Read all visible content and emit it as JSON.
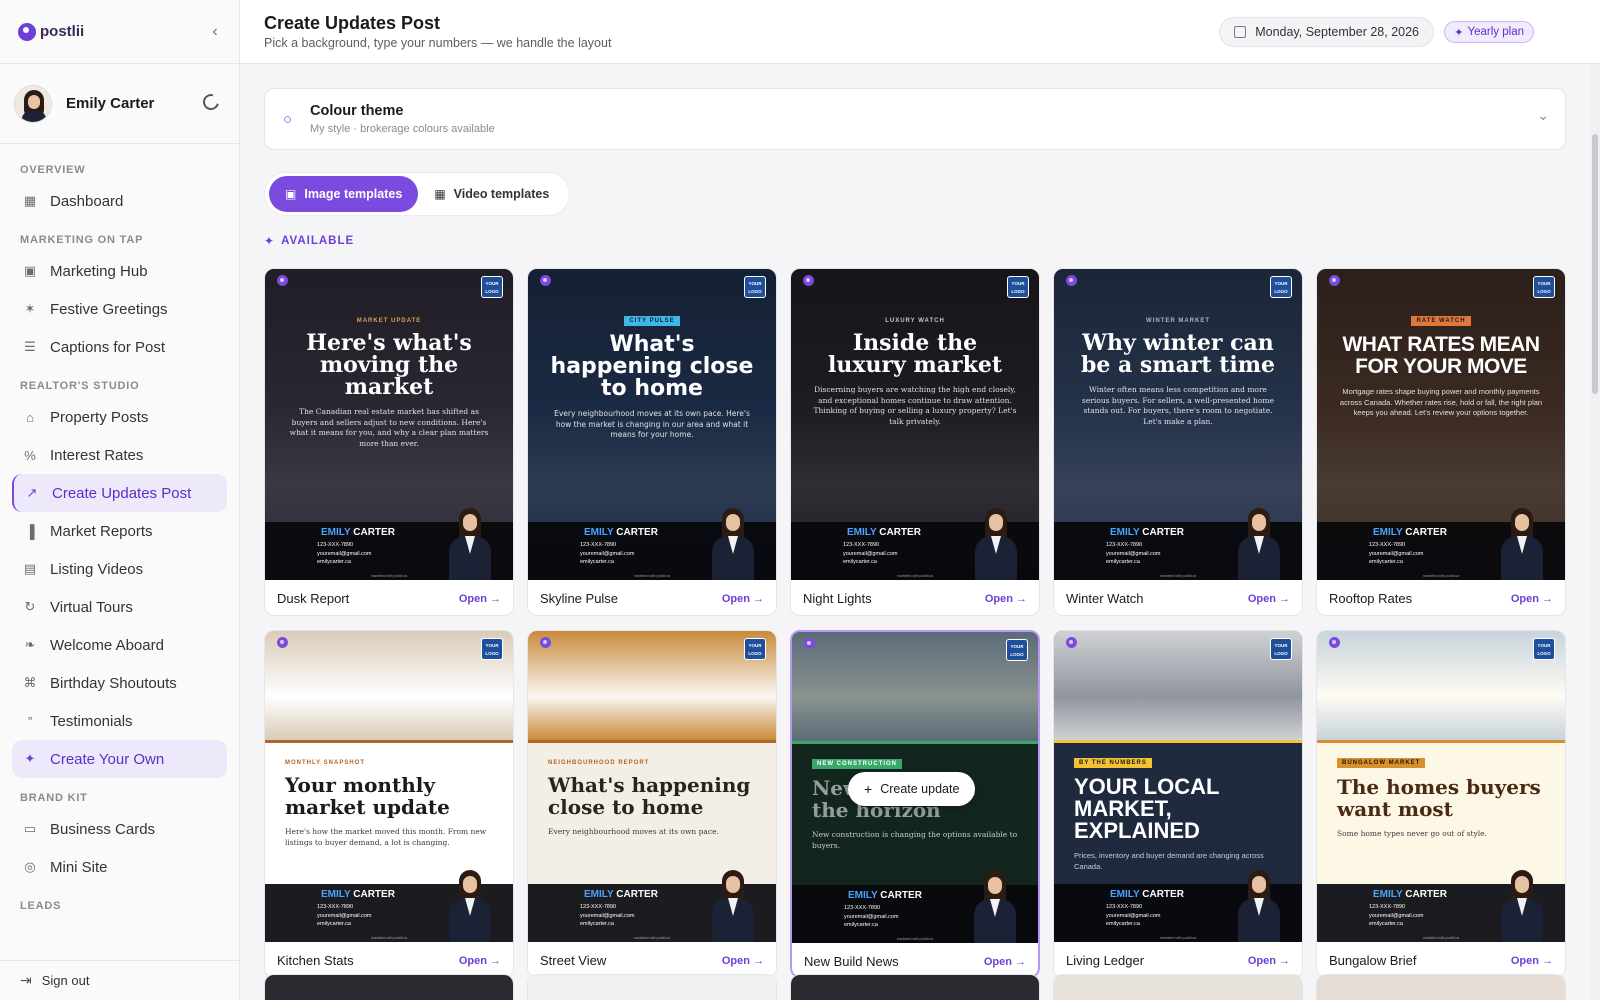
{
  "brand": {
    "name": "postlii"
  },
  "profile": {
    "name": "Emily Carter"
  },
  "nav": {
    "sections": [
      {
        "title": "OVERVIEW",
        "items": [
          {
            "label": "Dashboard",
            "icon": "grid-icon"
          }
        ]
      },
      {
        "title": "MARKETING ON TAP",
        "items": [
          {
            "label": "Marketing Hub",
            "icon": "image-icon"
          },
          {
            "label": "Festive Greetings",
            "icon": "party-icon"
          },
          {
            "label": "Captions for Post",
            "icon": "caption-icon"
          }
        ]
      },
      {
        "title": "REALTOR'S STUDIO",
        "items": [
          {
            "label": "Property Posts",
            "icon": "home-icon"
          },
          {
            "label": "Interest Rates",
            "icon": "percent-icon"
          },
          {
            "label": "Create Updates Post",
            "icon": "trend-icon",
            "active": true
          },
          {
            "label": "Market Reports",
            "icon": "bar-chart-icon"
          },
          {
            "label": "Listing Videos",
            "icon": "video-icon"
          },
          {
            "label": "Virtual Tours",
            "icon": "rotate-icon"
          },
          {
            "label": "Welcome Aboard",
            "icon": "handshake-icon"
          },
          {
            "label": "Birthday Shoutouts",
            "icon": "cake-icon"
          },
          {
            "label": "Testimonials",
            "icon": "quote-icon"
          },
          {
            "label": "Create Your Own",
            "icon": "sparkle-icon",
            "highlight": true
          }
        ]
      },
      {
        "title": "BRAND KIT",
        "items": [
          {
            "label": "Business Cards",
            "icon": "card-icon"
          },
          {
            "label": "Mini Site",
            "icon": "globe-icon"
          }
        ]
      },
      {
        "title": "LEADS",
        "items": []
      }
    ],
    "signout": "Sign out"
  },
  "header": {
    "title": "Create Updates Post",
    "subtitle": "Pick a background, type your numbers — we handle the layout",
    "date": "Monday, September 28, 2026",
    "plan": "Yearly plan"
  },
  "theme": {
    "title": "Colour theme",
    "subtitle": "My style · brokerage colours available"
  },
  "tabs": [
    {
      "label": "Image templates",
      "active": true
    },
    {
      "label": "Video templates",
      "active": false
    }
  ],
  "section_label": "AVAILABLE",
  "open_label": "Open →",
  "create_label": "Create update",
  "agent": {
    "first": "EMILY",
    "last": "CARTER",
    "phone": "123-XXX-7890",
    "email": "youremail@gmail.com",
    "site": "emilycarter.ca",
    "credit": "marketed with postlii.ca",
    "logo_text": "YOUR LOGO"
  },
  "templates": [
    {
      "name": "Dusk Report",
      "tag": "MARKET UPDATE",
      "headline": "Here's what's moving the market",
      "desc": "The Canadian real estate market has shifted as buyers and sellers adjust to new conditions. Here's what it means for you, and why a clear plan matters more than ever.",
      "style": "dark",
      "bg": "#2b2733",
      "accent": "#d9a04a",
      "font": "serif"
    },
    {
      "name": "Skyline Pulse",
      "tag": "CITY PULSE",
      "headline": "What's happening close to home",
      "desc": "Every neighbourhood moves at its own pace. Here's how the market is changing in our area and what it means for your home.",
      "style": "dark",
      "bg": "#1b2a44",
      "accent": "#3fb6e8",
      "font": "sans"
    },
    {
      "name": "Night Lights",
      "tag": "LUXURY WATCH",
      "headline": "Inside the luxury market",
      "desc": "Discerning buyers are watching the high end closely, and exceptional homes continue to draw attention. Thinking of buying or selling a luxury property? Let's talk privately.",
      "style": "dark",
      "bg": "#1e1c22",
      "accent": "#c8c8c8",
      "font": "serif"
    },
    {
      "name": "Winter Watch",
      "tag": "WINTER MARKET",
      "headline": "Why winter can be a smart time",
      "desc": "Winter often means less competition and more serious buyers. For sellers, a well-presented home stands out. For buyers, there's room to negotiate. Let's make a plan.",
      "style": "dark",
      "bg": "#24324a",
      "accent": "#9fb7d9",
      "font": "serif"
    },
    {
      "name": "Rooftop Rates",
      "tag": "RATE WATCH",
      "headline": "WHAT RATES MEAN FOR YOUR MOVE",
      "desc": "Mortgage rates shape buying power and monthly payments across Canada. Whether rates rise, hold or fall, the right plan keeps you ahead. Let's review your options together.",
      "style": "dark",
      "bg": "#3a2a22",
      "accent": "#e0783a",
      "font": "condensed"
    },
    {
      "name": "Kitchen Stats",
      "tag": "MONTHLY SNAPSHOT",
      "headline": "Your monthly market update",
      "desc": "Here's how the market moved this month. From new listings to buyer demand, a lot is changing.",
      "style": "light",
      "bg": "#ffffff",
      "photo": "#d9cbb8",
      "accent": "#b0642a",
      "text": "#1a1a1f",
      "font": "serif"
    },
    {
      "name": "Street View",
      "tag": "NEIGHBOURHOOD REPORT",
      "headline": "What's happening close to home",
      "desc": "Every neighbourhood moves at its own pace.",
      "style": "light",
      "bg": "#f4efe6",
      "photo": "#c98a3a",
      "accent": "#b0642a",
      "text": "#2a2420",
      "font": "serif"
    },
    {
      "name": "New Build News",
      "tag": "NEW CONSTRUCTION",
      "headline": "New homes on the horizon",
      "desc": "New construction is changing the options available to buyers.",
      "style": "panel",
      "bg": "#12261e",
      "photo": "#5b6b78",
      "accent": "#3aa86b",
      "text": "#ffffff",
      "font": "serif",
      "selected": true
    },
    {
      "name": "Living Ledger",
      "tag": "BY THE NUMBERS",
      "headline": "YOUR LOCAL MARKET, EXPLAINED",
      "desc": "Prices, inventory and buyer demand are changing across Canada.",
      "style": "panel",
      "bg": "#1f2a3e",
      "photo": "#cfd2d4",
      "accent": "#f2c233",
      "text": "#ffffff",
      "font": "condensed"
    },
    {
      "name": "Bungalow Brief",
      "tag": "BUNGALOW MARKET",
      "headline": "The homes buyers want most",
      "desc": "Some home types never go out of style.",
      "style": "light",
      "bg": "#fdf8e6",
      "photo": "#c8d3dc",
      "accent": "#d9902a",
      "text": "#4a2a14",
      "font": "serif"
    }
  ],
  "stubs": [
    "#2b2a30",
    "#f0f0f0",
    "#2a2a30",
    "#e7e2da",
    "#e6dcd6"
  ]
}
